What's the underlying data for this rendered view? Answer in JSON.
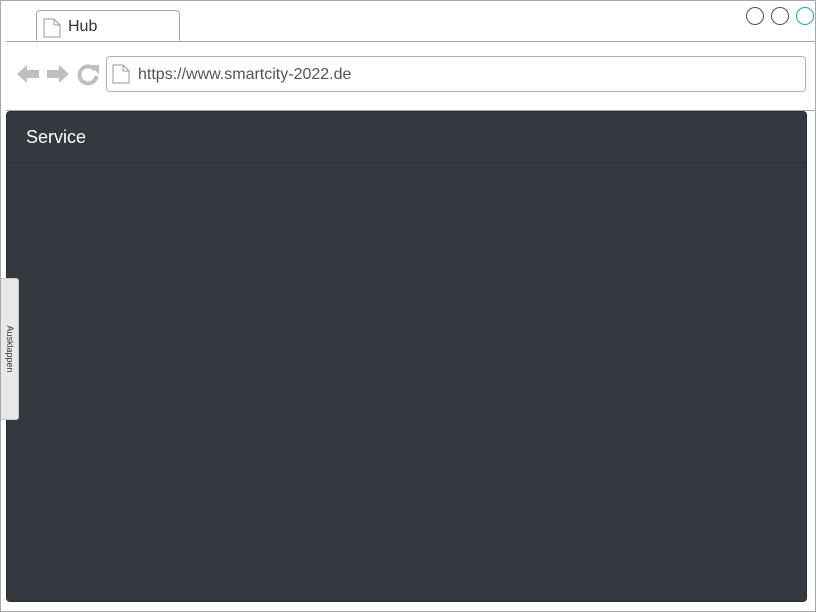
{
  "browser": {
    "tab": {
      "label": "Hub",
      "icon": "page-icon"
    },
    "window_controls": [
      "minimize-icon",
      "maximize-icon",
      "close-icon"
    ],
    "nav": {
      "icons": [
        "back-arrow-icon",
        "forward-arrow-icon",
        "reload-icon"
      ]
    },
    "url": "https://www.smartcity-2022.de"
  },
  "panel": {
    "title": "Service",
    "background": "#343940"
  },
  "side_tab": {
    "label": "Ausklappen"
  },
  "colors": {
    "accent": "#2a9fd8",
    "icon_gray": "#bfbfbf"
  }
}
